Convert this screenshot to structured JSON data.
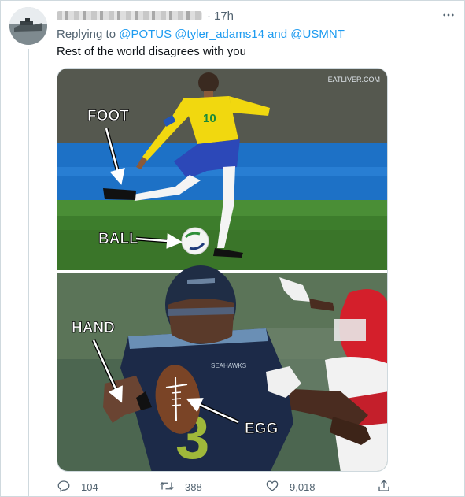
{
  "tweet": {
    "time": "17h",
    "separator": "·",
    "replying_prefix": "Replying to",
    "mentions": [
      "@POTUS",
      "@tyler_adams14",
      "@USMNT"
    ],
    "and_word": "and",
    "text": "Rest of the world disagrees with you"
  },
  "media": {
    "watermark": "EATLIVER.COM",
    "top_panel": {
      "label_foot": "FOOT",
      "label_ball": "BALL",
      "jersey_number": "10"
    },
    "bottom_panel": {
      "label_hand": "HAND",
      "label_egg": "EGG",
      "jersey_number": "3",
      "team_wordmark": "SEAHAWKS"
    }
  },
  "actions": {
    "reply_count": "104",
    "retweet_count": "388",
    "like_count": "9,018"
  },
  "icons": [
    "more-icon",
    "reply-icon",
    "retweet-icon",
    "like-icon",
    "share-icon"
  ],
  "colors": {
    "accent": "#1d9bf0",
    "secondary_text": "#536471",
    "border": "#cfd9de"
  }
}
